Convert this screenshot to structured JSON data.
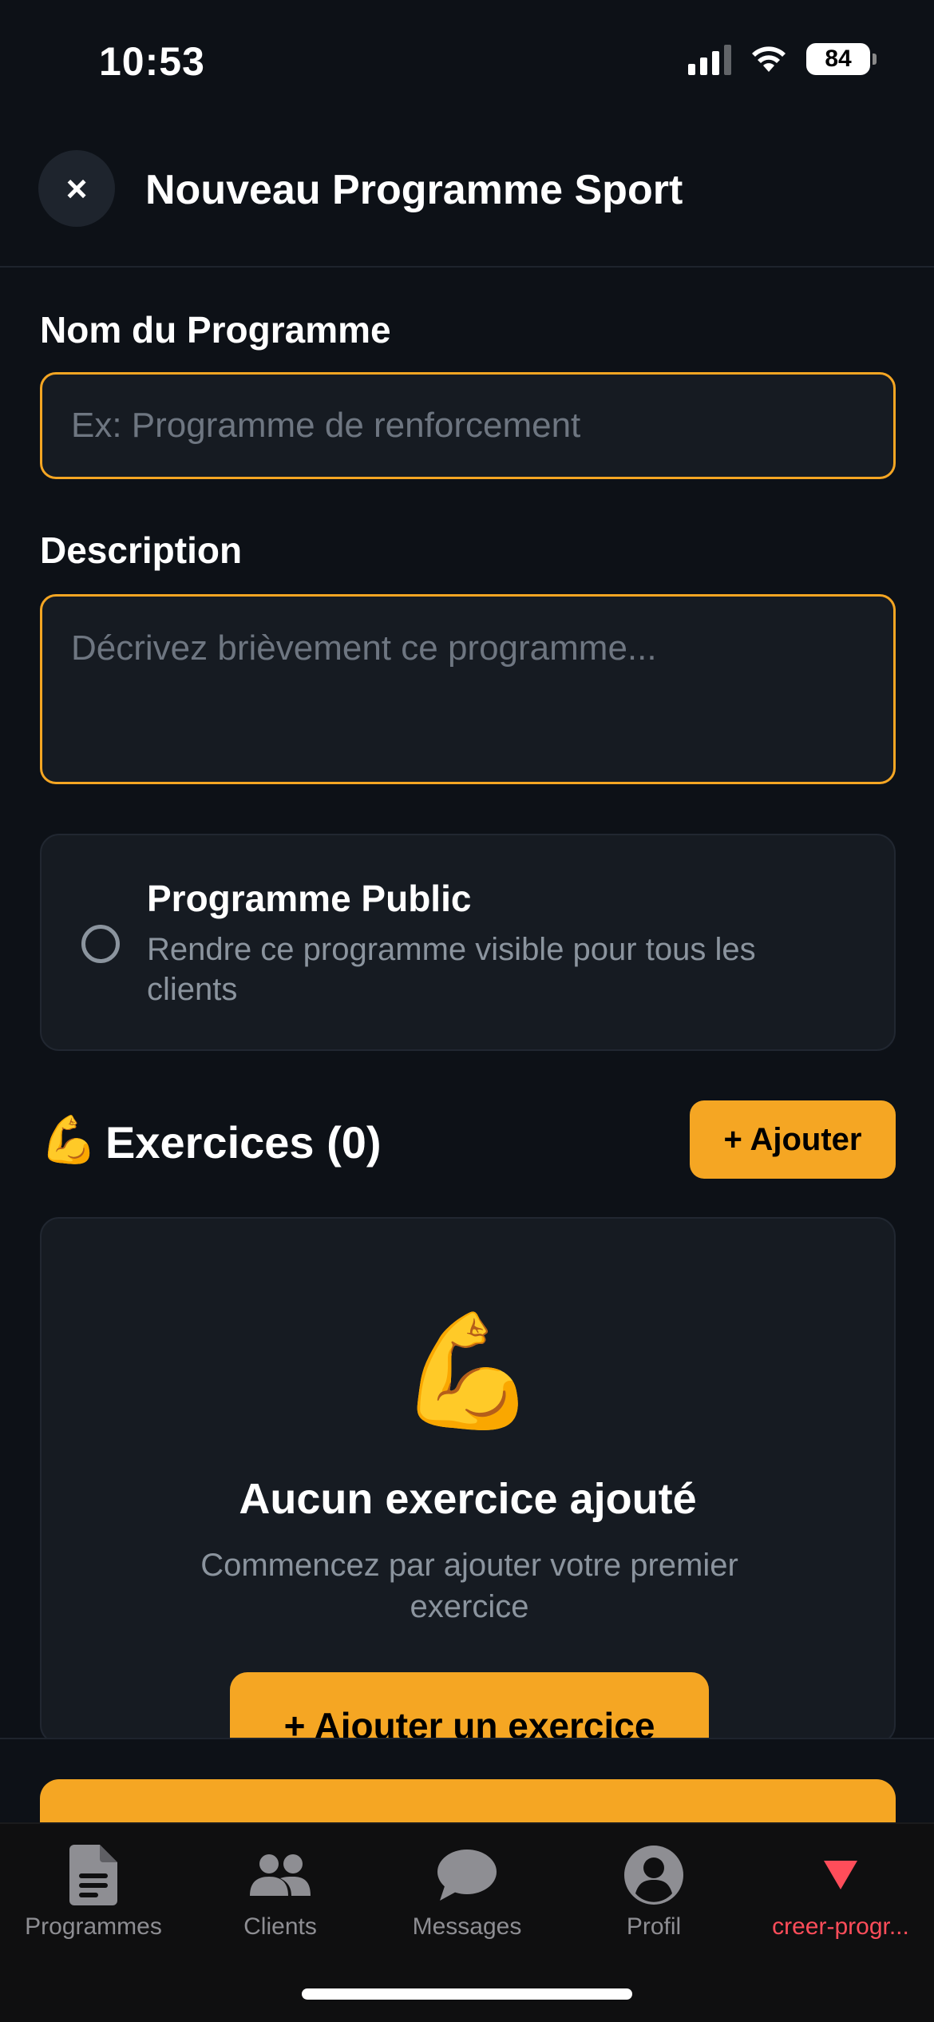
{
  "status_bar": {
    "time": "10:53",
    "battery": "84"
  },
  "header": {
    "close_label": "×",
    "title": "Nouveau Programme Sport"
  },
  "form": {
    "name_label": "Nom du Programme",
    "name_placeholder": "Ex: Programme de renforcement",
    "description_label": "Description",
    "description_placeholder": "Décrivez brièvement ce programme...",
    "public": {
      "title": "Programme Public",
      "description": "Rendre ce programme visible pour tous les clients",
      "checked": false
    }
  },
  "exercises": {
    "emoji": "💪",
    "title": "Exercices (0)",
    "add_label": "+ Ajouter",
    "empty": {
      "emoji": "💪",
      "title": "Aucun exercice ajouté",
      "description": "Commencez par ajouter votre premier exercice",
      "button_label": "+ Ajouter un exercice"
    }
  },
  "tab_bar": {
    "items": [
      {
        "label": "Programmes",
        "icon": "document-icon",
        "active": false
      },
      {
        "label": "Clients",
        "icon": "people-icon",
        "active": false
      },
      {
        "label": "Messages",
        "icon": "chat-bubble-icon",
        "active": false
      },
      {
        "label": "Profil",
        "icon": "user-circle-icon",
        "active": false
      },
      {
        "label": "creer-progr...",
        "icon": "triangle-down-icon",
        "active": true
      }
    ]
  },
  "colors": {
    "background": "#0d1117",
    "card": "#161b22",
    "accent": "#f5a623",
    "muted_text": "#8b949e",
    "active_tab": "#ff4d5a"
  }
}
